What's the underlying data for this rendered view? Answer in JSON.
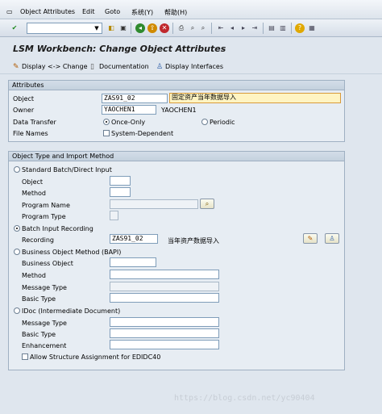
{
  "menu": {
    "items": [
      "Object Attributes",
      "Edit",
      "Goto",
      "系统(Y)",
      "帮助(H)"
    ]
  },
  "toolbar": {
    "enter_icon": "check-icon",
    "command_field": "",
    "icons": [
      "save-icon",
      "back-icon",
      "exit-icon",
      "cancel-icon",
      "print-icon",
      "find-icon",
      "find-next-icon",
      "first-page-icon",
      "prev-page-icon",
      "next-page-icon",
      "last-page-icon",
      "new-session-icon",
      "shortcut-icon",
      "help-icon",
      "settings-icon"
    ]
  },
  "title": "LSM Workbench: Change Object Attributes",
  "app_toolbar": {
    "display_change": "Display <-> Change",
    "documentation": "Documentation",
    "display_interfaces": "Display Interfaces"
  },
  "attributes": {
    "header": "Attributes",
    "object_label": "Object",
    "object_value": "ZAS91_02",
    "object_desc": "固定资产当年数据导入",
    "owner_label": "Owner",
    "owner_value": "YAOCHEN1",
    "owner_name": "YAOCHEN1",
    "data_transfer_label": "Data Transfer",
    "once_only": "Once-Only",
    "periodic": "Periodic",
    "file_names_label": "File Names",
    "system_dependent": "System-Dependent"
  },
  "import_method": {
    "header": "Object Type and Import Method",
    "standard_batch": "Standard Batch/Direct Input",
    "object_label": "Object",
    "method_label": "Method",
    "program_name_label": "Program Name",
    "program_type_label": "Program Type",
    "batch_input_recording": "Batch Input Recording",
    "recording_label": "Recording",
    "recording_value": "ZAS91_02",
    "recording_desc": "当年资产数据导入",
    "bapi": "Business Object Method (BAPI)",
    "business_object_label": "Business Object",
    "bapi_method_label": "Method",
    "message_type_label": "Message Type",
    "basic_type_label": "Basic Type",
    "idoc": "IDoc (Intermediate Document)",
    "idoc_message_type_label": "Message Type",
    "idoc_basic_type_label": "Basic Type",
    "enhancement_label": "Enhancement",
    "allow_structure": "Allow Structure Assignment for EDIDC40"
  },
  "watermark": "https://blog.csdn.net/yc90404"
}
